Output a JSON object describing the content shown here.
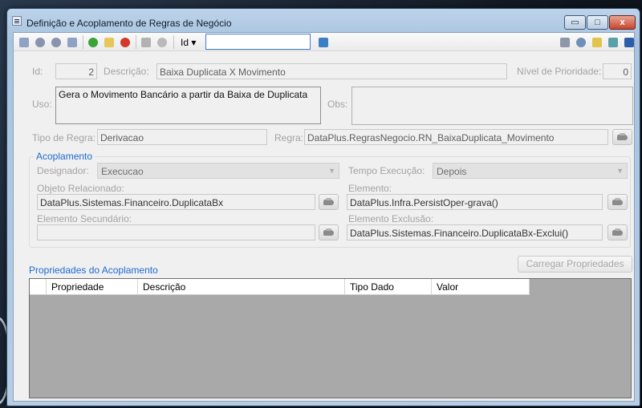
{
  "window": {
    "title": "Definição e Acoplamento de Regras de Negócio",
    "controls": {
      "minimize": "▭",
      "maximize": "□",
      "close": "x"
    }
  },
  "toolbar": {
    "id_label": "Id ▾",
    "id_value": "",
    "icons": [
      "first-record-icon",
      "previous-record-icon",
      "next-record-icon",
      "last-record-icon",
      "add-icon",
      "edit-icon",
      "delete-icon",
      "save-icon",
      "undo-icon",
      "search-grid-icon",
      "report-icon",
      "settings-icon",
      "clipboard-icon",
      "export-icon",
      "layout-icon"
    ]
  },
  "form": {
    "id_label": "Id:",
    "id_value": "2",
    "descricao_label": "Descrição:",
    "descricao_value": "Baixa Duplicata X Movimento",
    "prioridade_label": "Nível de Prioridade:",
    "prioridade_value": "0",
    "uso_label": "Uso:",
    "uso_value": "Gera o Movimento Bancário a partir da Baixa de Duplicata",
    "obs_label": "Obs:",
    "obs_value": "",
    "tipo_regra_label": "Tipo de Regra:",
    "tipo_regra_value": "Derivacao",
    "regra_label": "Regra:",
    "regra_value": "DataPlus.RegrasNegocio.RN_BaixaDuplicata_Movimento"
  },
  "acoplamento": {
    "title": "Acoplamento",
    "designador_label": "Designador:",
    "designador_value": "Execucao",
    "tempo_label": "Tempo Execução:",
    "tempo_value": "Depois",
    "objeto_label": "Objeto Relacionado:",
    "objeto_value": "DataPlus.Sistemas.Financeiro.DuplicataBx",
    "elemento_label": "Elemento:",
    "elemento_value": "DataPlus.Infra.PersistOper-grava()",
    "elemento_sec_label": "Elemento Secundário:",
    "elemento_sec_value": "",
    "elemento_exc_label": "Elemento Exclusão:",
    "elemento_exc_value": "DataPlus.Sistemas.Financeiro.DuplicataBx-Exclui()"
  },
  "propriedades": {
    "title": "Propriedades do Acoplamento",
    "load_button": "Carregar Propriedades",
    "columns": [
      "Propriedade",
      "Descrição",
      "Tipo Dado",
      "Valor"
    ]
  },
  "colors": {
    "accent": "#1d6ad1",
    "grid_background": "#a9a9a9",
    "close_button": "#c7452f"
  }
}
